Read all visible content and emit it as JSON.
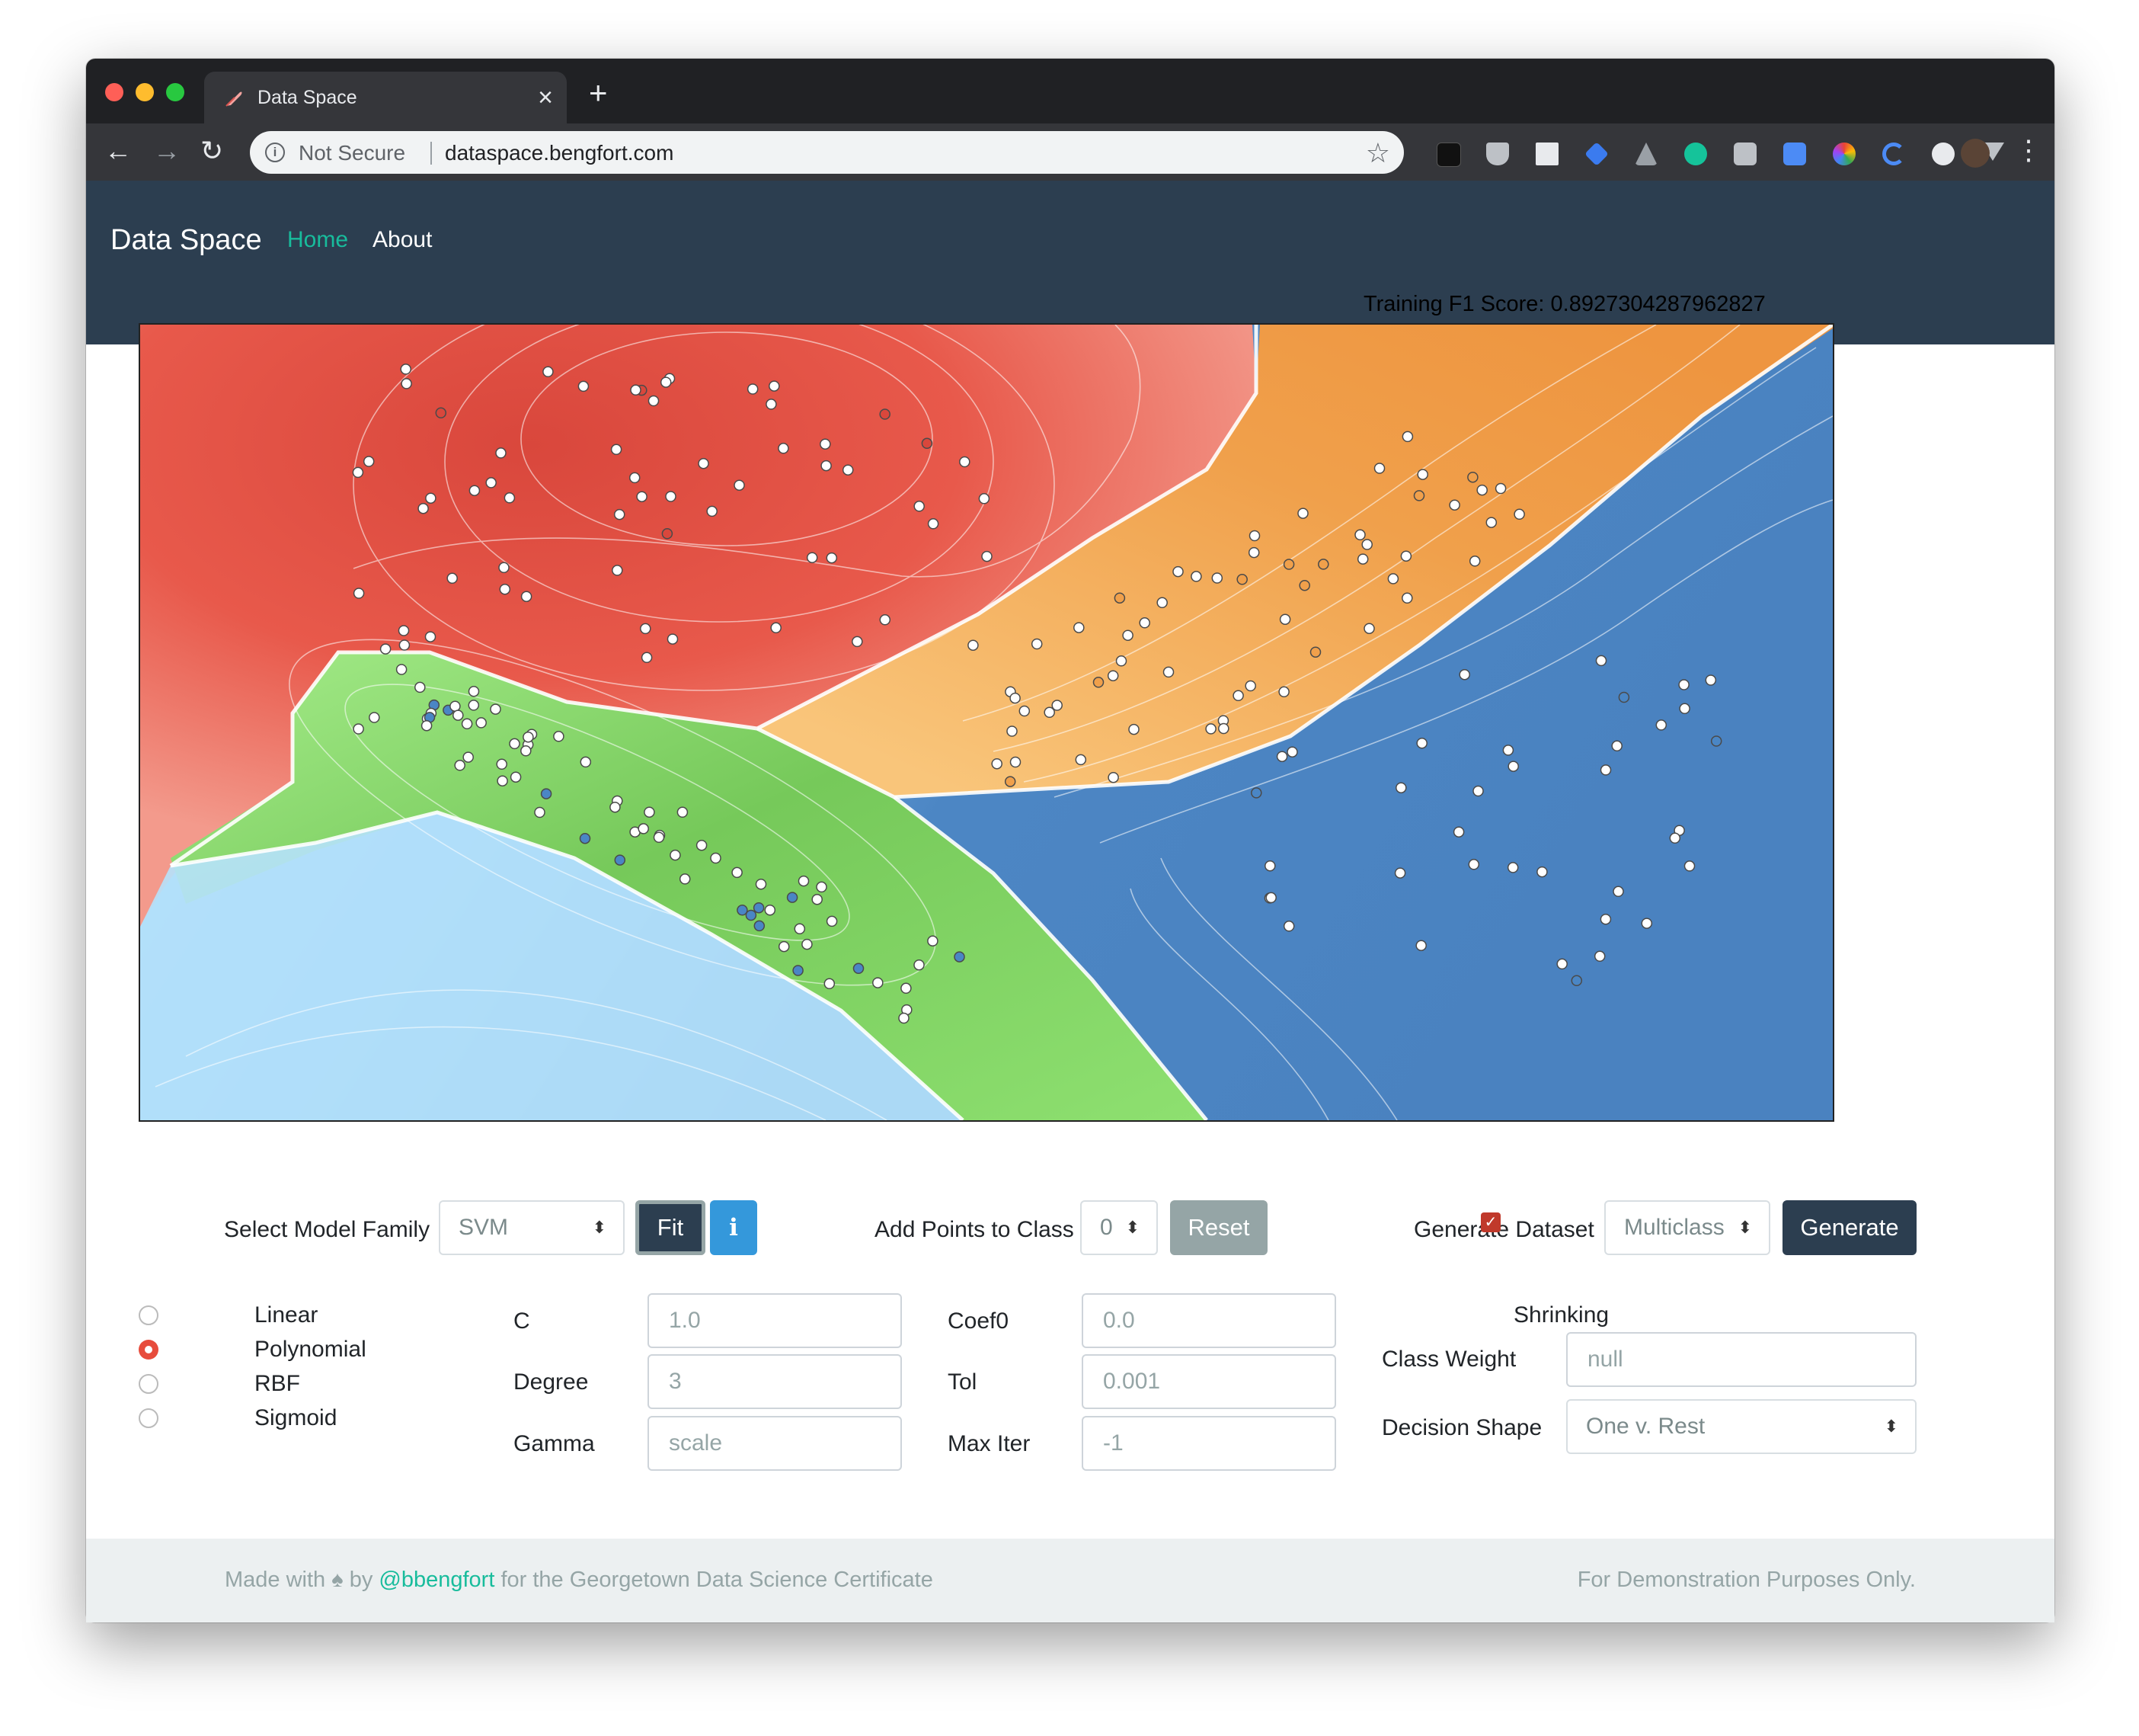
{
  "browser": {
    "tab_title": "Data Space",
    "security_label": "Not Secure",
    "url": "dataspace.bengfort.com"
  },
  "nav": {
    "brand": "Data Space",
    "links": [
      "Home",
      "About"
    ]
  },
  "score": "Training F1 Score: 0.8927304287962827",
  "controls": {
    "model_family_label": "Select Model Family",
    "model_family_value": "SVM",
    "fit_label": "Fit",
    "info_label": "i",
    "add_points_label": "Add Points to Class",
    "add_points_value": "0",
    "reset_label": "Reset",
    "generate_dataset_label": "Generate Dataset",
    "generate_dataset_value": "Multiclass",
    "generate_label": "Generate"
  },
  "kernels": {
    "options": [
      "Linear",
      "Polynomial",
      "RBF",
      "Sigmoid"
    ],
    "selected": "Polynomial"
  },
  "params": {
    "c_label": "C",
    "c_placeholder": "1.0",
    "degree_label": "Degree",
    "degree_placeholder": "3",
    "gamma_label": "Gamma",
    "gamma_placeholder": "scale",
    "coef0_label": "Coef0",
    "coef0_placeholder": "0.0",
    "tol_label": "Tol",
    "tol_placeholder": "0.001",
    "maxiter_label": "Max Iter",
    "maxiter_placeholder": "-1",
    "shrinking_label": "Shrinking",
    "shrinking_checked": true,
    "class_weight_label": "Class Weight",
    "class_weight_placeholder": "null",
    "decision_shape_label": "Decision Shape",
    "decision_shape_value": "One v. Rest"
  },
  "footer": {
    "made_with": "Made with",
    "by": "by",
    "twitter": "@bbengfort",
    "cert": "for the Georgetown Data Science Certificate",
    "right": "For Demonstration Purposes Only."
  },
  "colors": {
    "navbar": "#2c3e50",
    "accent": "#18bc9c",
    "class_red": "#e74c3c",
    "class_orange": "#f0a04b",
    "class_green": "#7ccf5b",
    "class_blue": "#4a86c5"
  }
}
